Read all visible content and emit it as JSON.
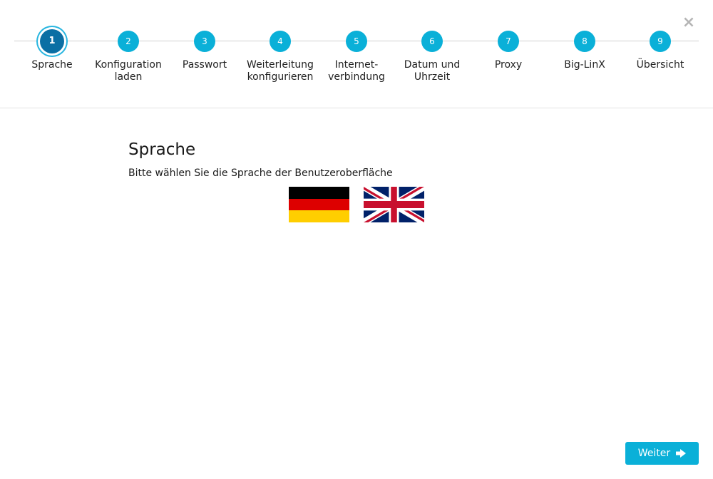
{
  "stepper": {
    "steps": [
      {
        "number": "1",
        "label": "Sprache",
        "active": true
      },
      {
        "number": "2",
        "label": "Konfiguration\nladen"
      },
      {
        "number": "3",
        "label": "Passwort"
      },
      {
        "number": "4",
        "label": "Weiterleitung\nkonfigurieren"
      },
      {
        "number": "5",
        "label": "Internet-\nverbindung"
      },
      {
        "number": "6",
        "label": "Datum und\nUhrzeit"
      },
      {
        "number": "7",
        "label": "Proxy"
      },
      {
        "number": "8",
        "label": "Big-LinX"
      },
      {
        "number": "9",
        "label": "Übersicht"
      }
    ],
    "close_symbol": "×"
  },
  "main": {
    "title": "Sprache",
    "subtitle": "Bitte wählen Sie die Sprache der Benutzeroberfläche",
    "languages": [
      {
        "flag": "german-flag-icon",
        "colors": [
          "#000000",
          "#dd0000",
          "#ffce00"
        ]
      },
      {
        "flag": "uk-flag-icon",
        "colors": [
          "#012169",
          "#ffffff",
          "#c8102e"
        ]
      }
    ]
  },
  "footer": {
    "next_label": "Weiter",
    "next_icon": "arrow-right-icon"
  },
  "colors": {
    "accent": "#0ab0d8",
    "active_step": "#0b6fa4"
  }
}
